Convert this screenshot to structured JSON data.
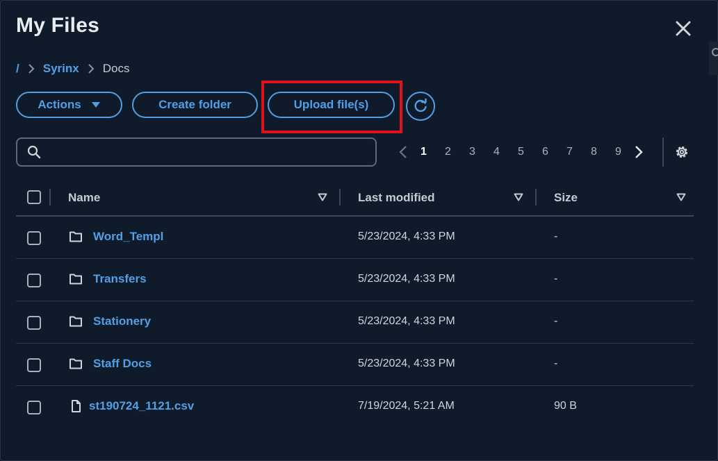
{
  "modal": {
    "title": "My Files",
    "close_icon": "close-icon"
  },
  "breadcrumb": {
    "root": "/",
    "items": [
      {
        "label": "Syrinx",
        "link": true
      },
      {
        "label": "Docs",
        "link": false
      }
    ]
  },
  "toolbar": {
    "actions_label": "Actions",
    "create_folder_label": "Create folder",
    "upload_label": "Upload file(s)",
    "refresh_icon": "refresh-icon"
  },
  "search": {
    "placeholder": "",
    "value": ""
  },
  "pagination": {
    "current": "1",
    "pages": [
      "1",
      "2",
      "3",
      "4",
      "5",
      "6",
      "7",
      "8",
      "9"
    ]
  },
  "table": {
    "columns": {
      "name": "Name",
      "modified": "Last modified",
      "size": "Size"
    },
    "rows": [
      {
        "type": "folder",
        "name": "Word_Templ",
        "modified": "5/23/2024, 4:33 PM",
        "size": "-"
      },
      {
        "type": "folder",
        "name": "Transfers",
        "modified": "5/23/2024, 4:33 PM",
        "size": "-"
      },
      {
        "type": "folder",
        "name": "Stationery",
        "modified": "5/23/2024, 4:33 PM",
        "size": "-"
      },
      {
        "type": "folder",
        "name": "Staff Docs",
        "modified": "5/23/2024, 4:33 PM",
        "size": "-"
      },
      {
        "type": "file",
        "name": "st190724_1121.csv",
        "modified": "7/19/2024, 5:21 AM",
        "size": "90 B"
      }
    ]
  },
  "colors": {
    "background": "#0f1b2a",
    "accent": "#539fe5",
    "highlight": "#e0131c"
  }
}
